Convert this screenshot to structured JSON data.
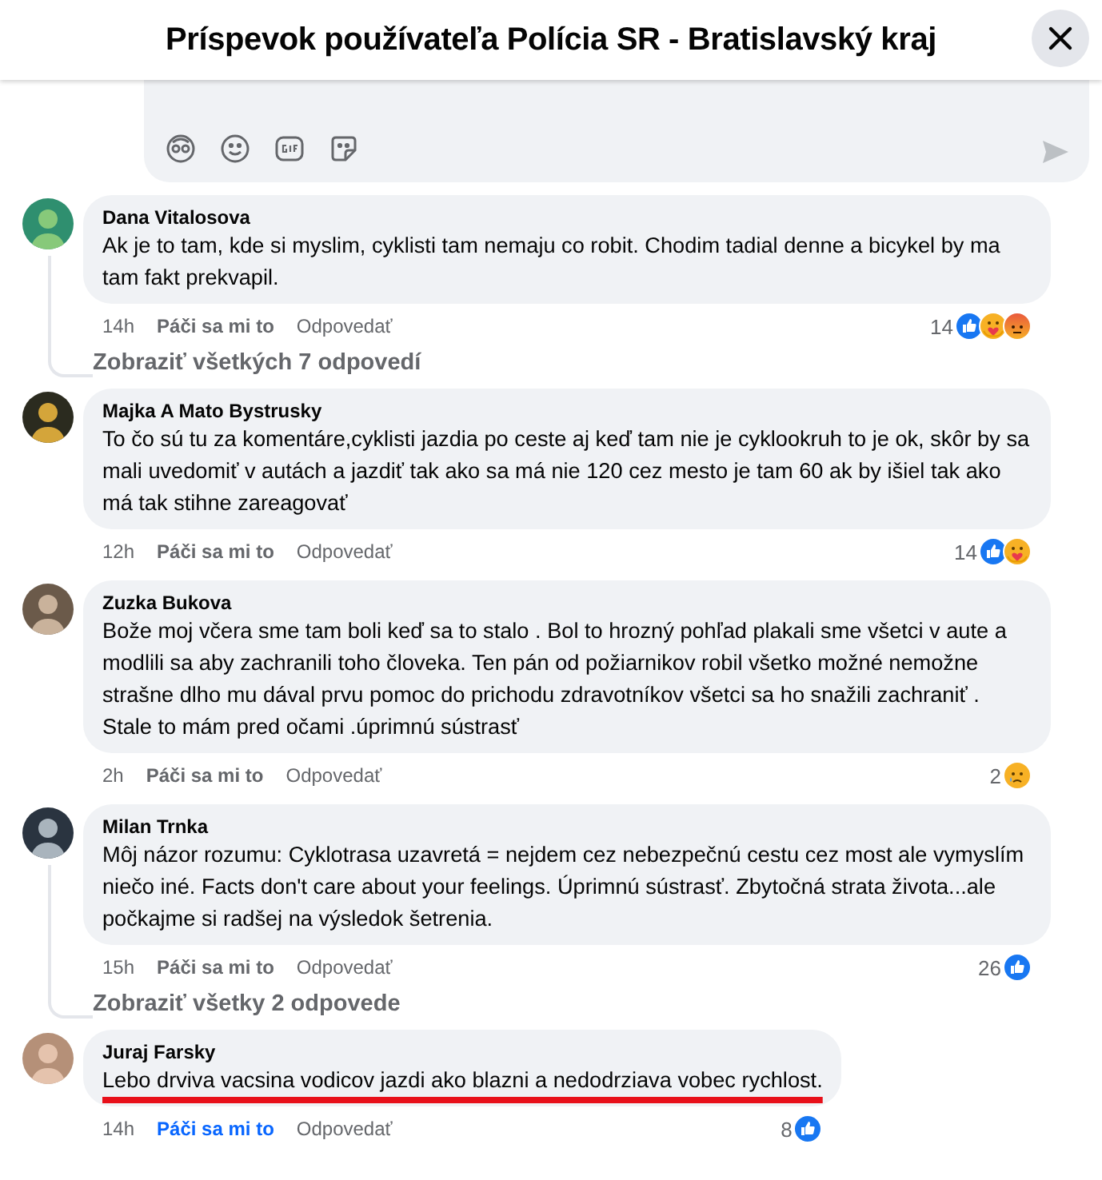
{
  "header": {
    "title": "Príspevok používateľa Polícia SR - Bratislavský kraj"
  },
  "composer": {
    "send_enabled": false
  },
  "comments": [
    {
      "name": "Dana Vitalosova",
      "text": "Ak je to tam, kde si myslim, cyklisti tam nemaju co robit. Chodim tadial denne a bicykel by ma tam fakt prekvapil.",
      "time": "14h",
      "like_label": "Páči sa mi to",
      "liked": false,
      "reply_label": "Odpovedať",
      "count": "14",
      "reactions": [
        {
          "kind": "like"
        },
        {
          "kind": "care"
        },
        {
          "kind": "angry"
        }
      ],
      "underlined": false,
      "replies_link": "Zobraziť všetkých 7 odpovedí"
    },
    {
      "name": "Majka A Mato Bystrusky",
      "text": "To čo sú tu za komentáre,cyklisti jazdia po ceste aj keď tam nie je cyklookruh to je ok, skôr by sa mali uvedomiť v autách a jazdiť tak ako sa má nie 120 cez mesto je tam 60 ak by išiel tak ako má tak stihne zareagovať",
      "time": "12h",
      "like_label": "Páči sa mi to",
      "liked": false,
      "reply_label": "Odpovedať",
      "count": "14",
      "reactions": [
        {
          "kind": "like"
        },
        {
          "kind": "care"
        }
      ],
      "underlined": false
    },
    {
      "name": "Zuzka Bukova",
      "text": "Bože moj včera sme tam boli keď sa to stalo . Bol to hrozný pohľad plakali sme všetci v aute a modlili sa aby zachranili toho človeka. Ten pán od požiarnikov robil všetko možné nemožne strašne dlho mu dával prvu pomoc do prichodu zdravotníkov všetci sa ho snažili zachraniť . Stale to mám pred očami .úprimnú sústrasť",
      "time": "2h",
      "like_label": "Páči sa mi to",
      "liked": false,
      "reply_label": "Odpovedať",
      "count": "2",
      "reactions": [
        {
          "kind": "sad"
        }
      ],
      "underlined": false
    },
    {
      "name": "Milan Trnka",
      "text": "Môj názor rozumu: Cyklotrasa uzavretá = nejdem cez nebezpečnú cestu cez most ale vymyslím niečo iné. Facts don't care about your feelings. Úprimnú sústrasť. Zbytočná strata života...ale počkajme si radšej na výsledok šetrenia.",
      "time": "15h",
      "like_label": "Páči sa mi to",
      "liked": false,
      "reply_label": "Odpovedať",
      "count": "26",
      "reactions": [
        {
          "kind": "like"
        }
      ],
      "underlined": false,
      "replies_link": "Zobraziť všetky 2 odpovede"
    },
    {
      "name": "Juraj Farsky",
      "text": "Lebo drviva vacsina vodicov jazdi ako blazni a nedodrziava vobec rychlost.",
      "time": "14h",
      "like_label": "Páči sa mi to",
      "liked": true,
      "reply_label": "Odpovedať",
      "count": "8",
      "reactions": [
        {
          "kind": "like"
        }
      ],
      "underlined": true
    }
  ]
}
